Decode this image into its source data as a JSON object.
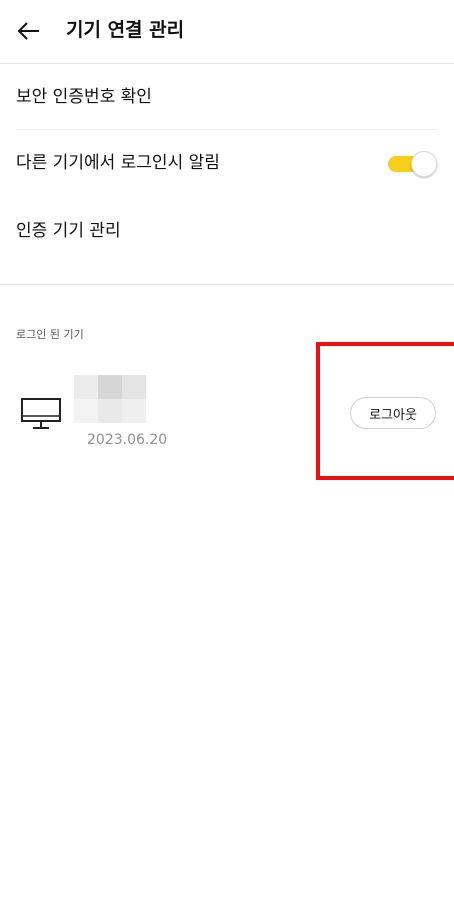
{
  "header": {
    "title": "기기 연결 관리",
    "back_icon": "back-arrow-icon"
  },
  "settings": {
    "items": [
      {
        "label": "보안 인증번호 확인"
      },
      {
        "label": "다른 기기에서 로그인시 알림",
        "toggle_on": true
      },
      {
        "label": "인증 기기 관리"
      }
    ]
  },
  "logged_in_devices": {
    "section_label": "로그인 된 기기",
    "devices": [
      {
        "icon": "monitor-icon",
        "date": "2023.06.20",
        "logout_label": "로그아웃"
      }
    ]
  },
  "colors": {
    "toggle_on": "#f5cf19",
    "highlight": "#ee0f0f"
  }
}
